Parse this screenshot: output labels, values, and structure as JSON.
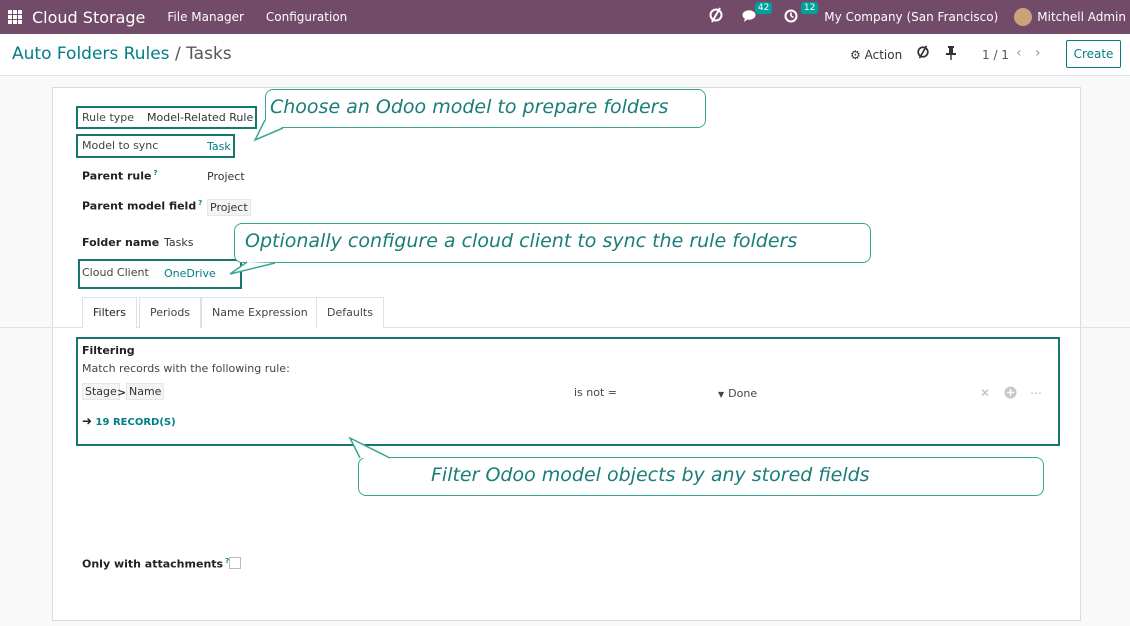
{
  "navbar": {
    "brand": "Cloud Storage",
    "menus": [
      "File Manager",
      "Configuration"
    ],
    "messages_count": "42",
    "activities_count": "12",
    "company": "My Company (San Francisco)",
    "user": "Mitchell Admin"
  },
  "control_panel": {
    "breadcrumb_parent": "Auto Folders Rules",
    "breadcrumb_separator": "/",
    "breadcrumb_current": "Tasks",
    "action_label": "Action",
    "pager": "1 / 1",
    "create_label": "Create"
  },
  "form": {
    "rule_type_label": "Rule type",
    "rule_type_value": "Model-Related Rule",
    "model_label": "Model to sync",
    "model_value": "Task",
    "parent_rule_label": "Parent rule",
    "parent_rule_value": "Project",
    "parent_field_label": "Parent model field",
    "parent_field_value": "Project",
    "folder_name_label": "Folder name",
    "folder_name_value": "Tasks",
    "cloud_client_label": "Cloud Client",
    "cloud_client_value": "OneDrive",
    "help_marker": "?",
    "only_attachments_label": "Only with attachments"
  },
  "tabs": [
    "Filters",
    "Periods",
    "Name Expression",
    "Defaults"
  ],
  "filter": {
    "title": "Filtering",
    "subtitle": "Match records with the following rule:",
    "path_1": "Stage",
    "path_separator": ">",
    "path_2": "Name",
    "operator": "is not =",
    "value": "Done",
    "records": "19 RECORD(S)"
  },
  "callouts": {
    "model": "Choose an Odoo model to prepare folders",
    "cloud": "Optionally configure a cloud client to sync the rule folders",
    "filter": "Filter Odoo model objects by any stored fields"
  },
  "colors": {
    "navbar": "#714b67",
    "accent": "#017e84",
    "highlight": "#17766e",
    "callout_border": "#3aa690"
  }
}
